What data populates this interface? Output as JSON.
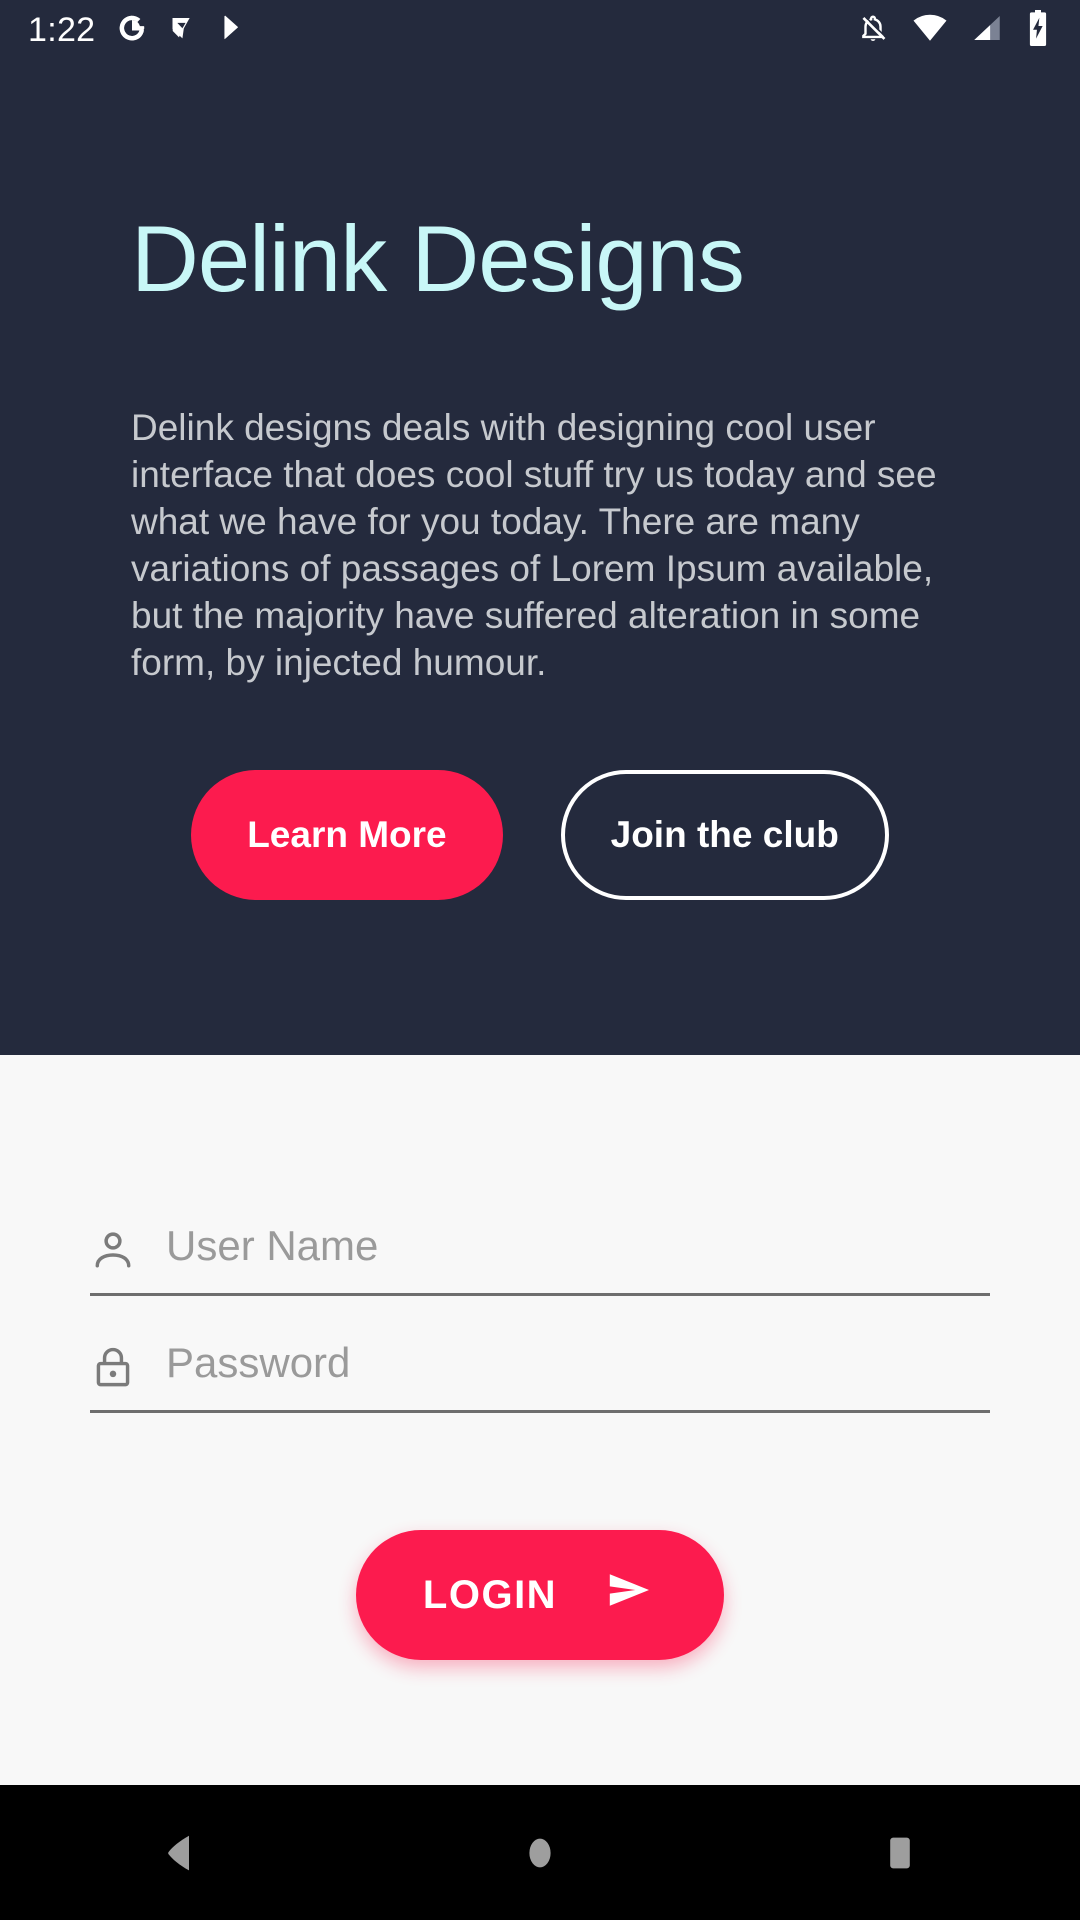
{
  "status_bar": {
    "time": "1:22",
    "left_icons": [
      "google-g-icon",
      "gmail-check-icon",
      "play-store-icon"
    ],
    "right_icons": [
      "notifications-off-icon",
      "wifi-icon",
      "cellular-signal-icon",
      "battery-charging-icon"
    ],
    "background_color": "#242A3D",
    "foreground_color": "#FFFFFF"
  },
  "hero": {
    "title": "Delink Designs",
    "title_color": "#C8F7F7",
    "body": "Delink designs deals with designing cool user interface that does cool stuff try us today and see what we have for you today. There are many variations of passages of Lorem Ipsum available, but the majority have suffered alteration in some form, by injected humour.",
    "body_color": "#C6C9CE",
    "background_color": "#242A3D",
    "primary_button_label": "Learn More",
    "secondary_button_label": "Join the club",
    "accent_color": "#FC1B4E"
  },
  "form": {
    "background_color": "#F8F8F8",
    "username": {
      "placeholder": "User Name",
      "value": "",
      "icon": "person-icon"
    },
    "password": {
      "placeholder": "Password",
      "value": "",
      "icon": "lock-icon"
    },
    "login_button": {
      "label": "LOGIN",
      "icon": "send-icon",
      "color": "#FC1B4E"
    },
    "underline_color": "#6E6E6E",
    "placeholder_color": "#9A9A9A"
  },
  "nav_bar": {
    "background_color": "#000000",
    "icon_color": "#9E9E9E",
    "buttons": [
      "back-button",
      "home-button",
      "recents-button"
    ]
  }
}
